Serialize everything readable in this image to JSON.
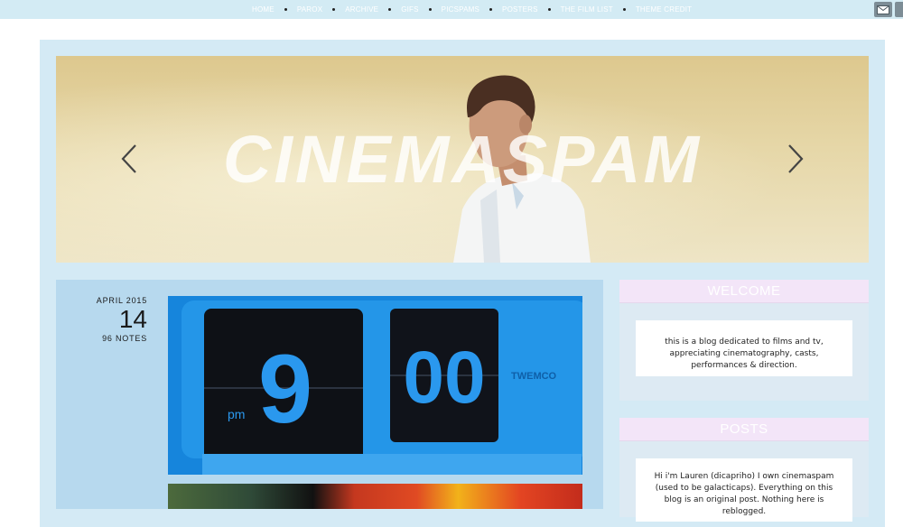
{
  "nav": {
    "items": [
      "HOME",
      "PAROX",
      "ARCHIVE",
      "GIFS",
      "PICSPAMS",
      "POSTERS",
      "THE FILM LIST",
      "THEME CREDIT"
    ]
  },
  "icons": {
    "mail": "envelope-icon",
    "prev": "chevron-left-icon",
    "next": "chevron-right-icon"
  },
  "banner": {
    "title": "CINEMASPAM"
  },
  "post": {
    "month": "APRIL 2015",
    "day": "14",
    "notes": "96 NOTES",
    "clock_hour": "9",
    "clock_minutes": "00",
    "clock_pm": "pm",
    "clock_brand": "TWEMCO"
  },
  "sidebar": {
    "welcome": {
      "title": "WELCOME",
      "text": "this is a blog dedicated to films and tv, appreciating cinematography, casts, performances & direction."
    },
    "posts": {
      "title": "POSTS",
      "text": "Hi i'm Lauren (dicapriho) I own cinemaspam (used to be galacticaps). Everything on this blog is an original post. Nothing here is reblogged."
    }
  },
  "colors": {
    "frame": "#d4eaf5",
    "posts_bg": "#b7d9ee",
    "widget_head": "#f3e5f8",
    "topbar": "#d3ebf4"
  }
}
